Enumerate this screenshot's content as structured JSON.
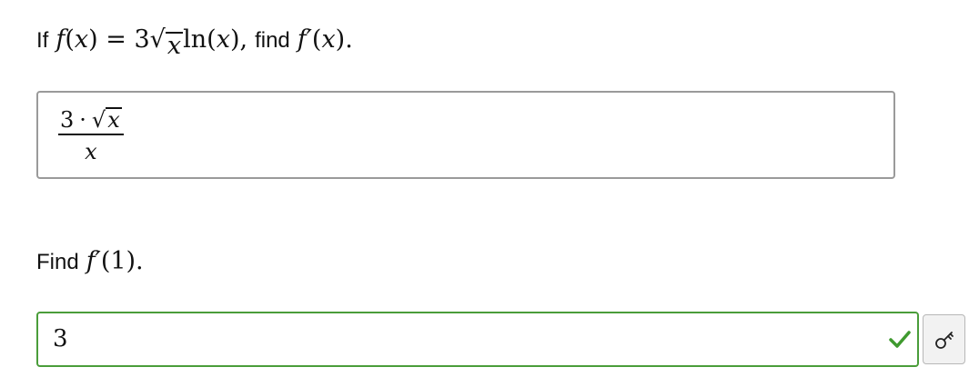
{
  "question_1": {
    "lead": "If",
    "f_sym": "f",
    "open_paren": "(",
    "x_sym": "x",
    "close_paren": ")",
    "equals": "=",
    "coef": "3",
    "sqrt_sign": "√",
    "sqrt_arg": "x",
    "ln": "ln",
    "ln_open": "(",
    "ln_arg": "x",
    "ln_close": "),",
    "find_text": "find",
    "fprime_sym": "f′",
    "fprime_open": "(",
    "fprime_arg": "x",
    "fprime_close": ").",
    "answer": {
      "numerator_coef": "3",
      "dot": "·",
      "sqrt_sign": "√",
      "sqrt_arg": "x",
      "denominator": "x"
    }
  },
  "question_2": {
    "lead": "Find",
    "fprime_sym": "f′",
    "arg": "(1).",
    "answer_value": "3",
    "status": "correct"
  },
  "colors": {
    "correct_border": "#4a9d3a",
    "correct_check": "#3f9a2f",
    "neutral_border": "#9a9a9a"
  },
  "icons": {
    "status_icon": "checkmark-icon",
    "key_button_icon": "key-icon"
  }
}
